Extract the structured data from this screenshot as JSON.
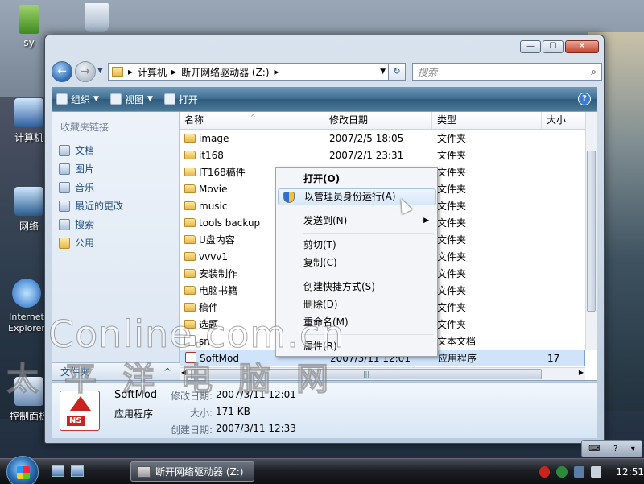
{
  "desktop": {
    "icons": [
      {
        "label": "sy"
      },
      {
        "label": ""
      },
      {
        "label": "计算机"
      },
      {
        "label": "网络"
      },
      {
        "label": "Internet Explorer"
      },
      {
        "label": "控制面板"
      }
    ]
  },
  "window": {
    "controls": {
      "minimize": "—",
      "maximize": "☐",
      "close": "✕"
    },
    "address": {
      "segments": [
        "计算机",
        "断开网络驱动器 (Z:)"
      ],
      "separator": "▸"
    },
    "search": {
      "placeholder": "搜索",
      "icon": "search-icon"
    },
    "toolbar": {
      "organize": "组织",
      "views": "视图",
      "open": "打开",
      "help": "?"
    }
  },
  "nav_pane": {
    "title": "收藏夹链接",
    "items": [
      "文档",
      "图片",
      "音乐",
      "最近的更改",
      "搜索",
      "公用"
    ],
    "folders_label": "文件夹"
  },
  "file_list": {
    "columns": [
      "名称",
      "修改日期",
      "类型",
      "大小"
    ],
    "rows": [
      {
        "name": "image",
        "date": "2007/2/5 18:05",
        "type": "文件夹",
        "size": ""
      },
      {
        "name": "it168",
        "date": "2007/2/1 23:31",
        "type": "文件夹",
        "size": ""
      },
      {
        "name": "IT168稿件",
        "date": "",
        "type": "文件夹",
        "size": ""
      },
      {
        "name": "Movie",
        "date": "",
        "type": "文件夹",
        "size": ""
      },
      {
        "name": "music",
        "date": "",
        "type": "文件夹",
        "size": ""
      },
      {
        "name": "tools backup",
        "date": "",
        "type": "文件夹",
        "size": ""
      },
      {
        "name": "U盘内容",
        "date": "",
        "type": "文件夹",
        "size": ""
      },
      {
        "name": "vvvv1",
        "date": "",
        "type": "文件夹",
        "size": ""
      },
      {
        "name": "安装制作",
        "date": "",
        "type": "文件夹",
        "size": ""
      },
      {
        "name": "电脑书籍",
        "date": "",
        "type": "文件夹",
        "size": ""
      },
      {
        "name": "稿件",
        "date": "",
        "type": "文件夹",
        "size": ""
      },
      {
        "name": "选题",
        "date": "",
        "type": "文件夹",
        "size": ""
      },
      {
        "name": "sn",
        "date": "",
        "type": "文本文档",
        "size": ""
      },
      {
        "name": "SoftMod",
        "date": "2007/3/11 12:01",
        "type": "应用程序",
        "size": "17"
      }
    ]
  },
  "context_menu": {
    "items": [
      "打开(O)",
      "以管理员身份运行(A)",
      "发送到(N)",
      "剪切(T)",
      "复制(C)",
      "创建快捷方式(S)",
      "删除(D)",
      "重命名(M)",
      "属性(R)"
    ]
  },
  "details": {
    "name": "SoftMod",
    "type": "应用程序",
    "modified_label": "修改日期:",
    "modified_value": "2007/3/11 12:01",
    "size_label": "大小:",
    "size_value": "171 KB",
    "created_label": "创建日期:",
    "created_value": "2007/3/11 12:33"
  },
  "watermark": {
    "line1": "Conline.com.cn",
    "line2": "太平洋电脑网"
  },
  "taskbar": {
    "task_label": "断开网络驱动器 (Z:)",
    "clock": "12:51"
  }
}
